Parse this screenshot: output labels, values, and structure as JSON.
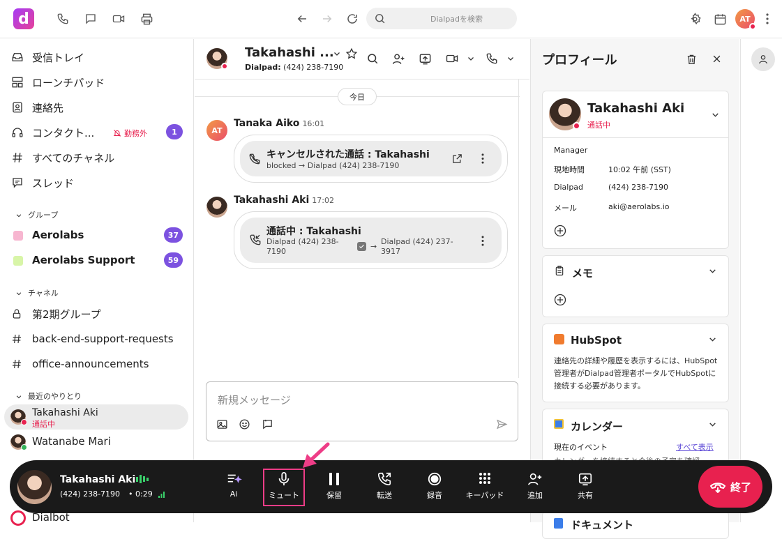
{
  "topbar": {
    "logo_letter": "d",
    "search_placeholder": "Dialpadを検索",
    "user_initials": "AT"
  },
  "sidebar": {
    "nav": [
      {
        "label": "受信トレイ",
        "icon": "inbox-icon"
      },
      {
        "label": "ローンチパッド",
        "icon": "launchpad-icon"
      },
      {
        "label": "連絡先",
        "icon": "contacts-icon"
      },
      {
        "label": "コンタクト...",
        "icon": "headset-icon",
        "status": "勤務外",
        "badge": "1"
      },
      {
        "label": "すべてのチャネル",
        "icon": "hash-icon"
      },
      {
        "label": "スレッド",
        "icon": "threads-icon"
      }
    ],
    "groups_title": "グループ",
    "groups": [
      {
        "label": "Aerolabs",
        "badge": "37",
        "color": "#f7b6d0"
      },
      {
        "label": "Aerolabs Support",
        "badge": "59",
        "color": "#d8f5a8"
      }
    ],
    "channels_title": "チャネル",
    "channels": [
      {
        "label": "第2期グループ",
        "icon": "lock-icon"
      },
      {
        "label": "back-end-support-requests",
        "icon": "hash-icon"
      },
      {
        "label": "office-announcements",
        "icon": "hash-icon"
      }
    ],
    "recent_title": "最近のやりとり",
    "recent": [
      {
        "label": "Takahashi Aki",
        "status": "通話中"
      },
      {
        "label": "Watanabe Mari"
      },
      {
        "label": "Dialbot"
      }
    ]
  },
  "conversation": {
    "contact_name": "Takahashi ...",
    "contact_line_label": "Dialpad:",
    "contact_line_number": "(424) 238-7190",
    "date_divider": "今日",
    "messages": [
      {
        "sender": "Tanaka Aiko",
        "initials": "AT",
        "time": "16:01",
        "title": "キャンセルされた通話 : Takahashi",
        "detail_from": "blocked",
        "detail_to": "Dialpad (424) 238-7190"
      },
      {
        "sender": "Takahashi Aki",
        "time": "17:02",
        "title": "通話中 : Takahashi",
        "detail_from": "Dialpad (424) 238-7190",
        "detail_to": "Dialpad (424) 237-3917"
      }
    ],
    "composer_placeholder": "新規メッセージ"
  },
  "profile": {
    "title": "プロフィール",
    "name": "Takahashi Aki",
    "status": "通話中",
    "role": "Manager",
    "fields": [
      {
        "label": "現地時間",
        "value": "10:02 午前 (SST)"
      },
      {
        "label": "Dialpad",
        "value": "(424) 238-7190"
      },
      {
        "label": "メール",
        "value": "aki@aerolabs.io"
      }
    ],
    "memo_title": "メモ",
    "hubspot_title": "HubSpot",
    "hubspot_text": "連絡先の詳細や履歴を表示するには、HubSpot管理者がDialpad管理者ポータルでHubSpotに接続する必要があります。",
    "calendar_title": "カレンダー",
    "calendar_current": "現在のイベント",
    "calendar_show_all": "すべて表示",
    "calendar_hint": "カレンダーを接続すると今後の予定を確認",
    "documents_title": "ドキュメント"
  },
  "callbar": {
    "name": "Takahashi Aki",
    "number": "(424) 238-7190",
    "duration": "0:29",
    "buttons": [
      {
        "label": "Ai",
        "icon": "ai-icon"
      },
      {
        "label": "ミュート",
        "icon": "microphone-icon"
      },
      {
        "label": "保留",
        "icon": "pause-icon"
      },
      {
        "label": "転送",
        "icon": "transfer-icon"
      },
      {
        "label": "録音",
        "icon": "record-icon"
      },
      {
        "label": "キーパッド",
        "icon": "keypad-icon"
      },
      {
        "label": "追加",
        "icon": "add-person-icon"
      },
      {
        "label": "共有",
        "icon": "share-screen-icon"
      }
    ],
    "end_label": "終了"
  },
  "colors": {
    "accent": "#7c52e0",
    "danger": "#e8214f",
    "highlight": "#ee3d87"
  }
}
